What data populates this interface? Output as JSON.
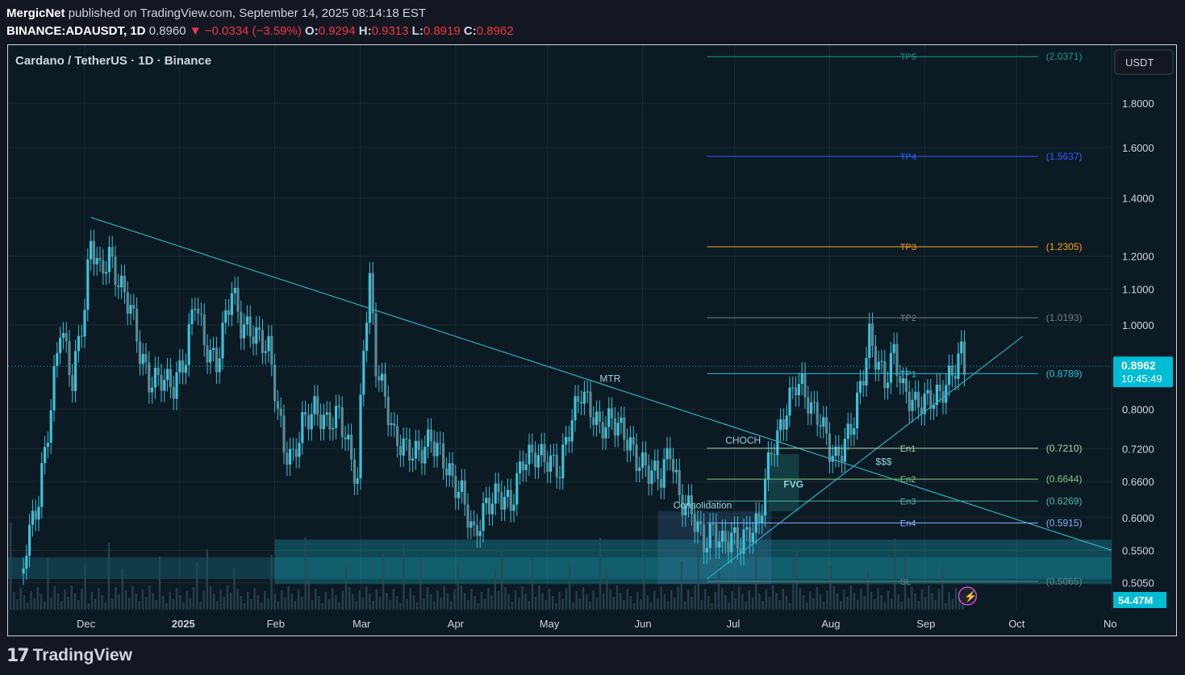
{
  "header": {
    "author": "MergicNet",
    "published_text": "published on TradingView.com, September 14, 2025 08:14:18 EST",
    "symbol": "BINANCE:ADAUSDT, 1D",
    "last": "0.8960",
    "change": "▼ −0.0334 (−3.59%)",
    "open_label": "O:",
    "open": "0.9294",
    "high_label": "H:",
    "high": "0.9313",
    "low_label": "L:",
    "low": "0.8919",
    "close_label": "C:",
    "close": "0.8962"
  },
  "legend": {
    "title": "Cardano / TetherUS · 1D · Binance"
  },
  "footer": {
    "brand": "TradingView"
  },
  "colors": {
    "bg": "#0c1a24",
    "candle": "#3dc1d9",
    "grid": "#1c2b35",
    "trend": "#2ab0c5",
    "tp3": "#f7a21b",
    "tp4": "#2962ff",
    "tp5": "#1b9a88",
    "tp2": "#787b86",
    "tp1": "#26c6da",
    "en1": "#a5d6a7",
    "en2": "#81c784",
    "en3": "#4db6ac",
    "en4": "#82b1ff",
    "sl": "#5d8a8a",
    "zone": "#17a3b3",
    "price": "#00bcd4"
  },
  "chart_data": {
    "type": "candlestick",
    "symbol": "Cardano / TetherUS",
    "timeframe": "1D",
    "exchange": "Binance",
    "currency_label": "USDT",
    "y_scale": "log",
    "ylim": [
      0.47,
      2.1
    ],
    "x_start": "2024-11-06",
    "x_end": "2025-11-01",
    "x_ticks": [
      {
        "date": "2024-12-01",
        "label": "Dec",
        "bold": false
      },
      {
        "date": "2025-01-01",
        "label": "2025",
        "bold": true
      },
      {
        "date": "2025-02-01",
        "label": "Feb",
        "bold": false
      },
      {
        "date": "2025-03-01",
        "label": "Mar",
        "bold": false
      },
      {
        "date": "2025-04-01",
        "label": "Apr",
        "bold": false
      },
      {
        "date": "2025-05-01",
        "label": "May",
        "bold": false
      },
      {
        "date": "2025-06-01",
        "label": "Jun",
        "bold": false
      },
      {
        "date": "2025-07-01",
        "label": "Jul",
        "bold": false
      },
      {
        "date": "2025-08-01",
        "label": "Aug",
        "bold": false
      },
      {
        "date": "2025-09-01",
        "label": "Sep",
        "bold": false
      },
      {
        "date": "2025-10-01",
        "label": "Oct",
        "bold": false
      },
      {
        "date": "2025-11-01",
        "label": "No",
        "bold": false
      }
    ],
    "y_ticks": [
      {
        "value": 1.8,
        "label": "1.8000"
      },
      {
        "value": 1.6,
        "label": "1.6000"
      },
      {
        "value": 1.4,
        "label": "1.4000"
      },
      {
        "value": 1.2,
        "label": "1.2000"
      },
      {
        "value": 1.1,
        "label": "1.1000"
      },
      {
        "value": 1.0,
        "label": "1.0000"
      },
      {
        "value": 0.8,
        "label": "0.8000"
      },
      {
        "value": 0.72,
        "label": "0.7200"
      },
      {
        "value": 0.66,
        "label": "0.6600"
      },
      {
        "value": 0.6,
        "label": "0.6000"
      },
      {
        "value": 0.55,
        "label": "0.5500"
      },
      {
        "value": 0.505,
        "label": "0.5050"
      }
    ],
    "close_path": [
      [
        "2024-11-06",
        0.38
      ],
      [
        "2024-11-12",
        0.56
      ],
      [
        "2024-11-16",
        0.63
      ],
      [
        "2024-11-20",
        0.8
      ],
      [
        "2024-11-23",
        1.0
      ],
      [
        "2024-11-27",
        0.86
      ],
      [
        "2024-12-01",
        1.05
      ],
      [
        "2024-12-03",
        1.25
      ],
      [
        "2024-12-06",
        1.15
      ],
      [
        "2024-12-09",
        1.2
      ],
      [
        "2024-12-12",
        1.12
      ],
      [
        "2024-12-16",
        1.05
      ],
      [
        "2024-12-19",
        0.93
      ],
      [
        "2024-12-22",
        0.86
      ],
      [
        "2024-12-26",
        0.87
      ],
      [
        "2024-12-30",
        0.85
      ],
      [
        "2025-01-03",
        0.92
      ],
      [
        "2025-01-06",
        1.08
      ],
      [
        "2025-01-09",
        0.95
      ],
      [
        "2025-01-13",
        0.9
      ],
      [
        "2025-01-18",
        1.1
      ],
      [
        "2025-01-21",
        1.0
      ],
      [
        "2025-01-25",
        0.98
      ],
      [
        "2025-01-30",
        0.94
      ],
      [
        "2025-02-02",
        0.8
      ],
      [
        "2025-02-04",
        0.72
      ],
      [
        "2025-02-07",
        0.7
      ],
      [
        "2025-02-10",
        0.77
      ],
      [
        "2025-02-14",
        0.8
      ],
      [
        "2025-02-18",
        0.77
      ],
      [
        "2025-02-22",
        0.79
      ],
      [
        "2025-02-26",
        0.7
      ],
      [
        "2025-02-28",
        0.66
      ],
      [
        "2025-03-02",
        0.95
      ],
      [
        "2025-03-04",
        1.12
      ],
      [
        "2025-03-06",
        0.9
      ],
      [
        "2025-03-08",
        0.85
      ],
      [
        "2025-03-12",
        0.74
      ],
      [
        "2025-03-16",
        0.72
      ],
      [
        "2025-03-20",
        0.71
      ],
      [
        "2025-03-24",
        0.74
      ],
      [
        "2025-03-28",
        0.7
      ],
      [
        "2025-03-31",
        0.66
      ],
      [
        "2025-04-03",
        0.64
      ],
      [
        "2025-04-07",
        0.57
      ],
      [
        "2025-04-11",
        0.62
      ],
      [
        "2025-04-15",
        0.64
      ],
      [
        "2025-04-19",
        0.62
      ],
      [
        "2025-04-23",
        0.7
      ],
      [
        "2025-04-27",
        0.71
      ],
      [
        "2025-05-01",
        0.7
      ],
      [
        "2025-05-05",
        0.68
      ],
      [
        "2025-05-08",
        0.76
      ],
      [
        "2025-05-12",
        0.84
      ],
      [
        "2025-05-15",
        0.8
      ],
      [
        "2025-05-18",
        0.76
      ],
      [
        "2025-05-22",
        0.78
      ],
      [
        "2025-05-26",
        0.75
      ],
      [
        "2025-05-30",
        0.7
      ],
      [
        "2025-06-03",
        0.68
      ],
      [
        "2025-06-07",
        0.67
      ],
      [
        "2025-06-10",
        0.72
      ],
      [
        "2025-06-13",
        0.63
      ],
      [
        "2025-06-17",
        0.61
      ],
      [
        "2025-06-21",
        0.56
      ],
      [
        "2025-06-24",
        0.58
      ],
      [
        "2025-06-27",
        0.56
      ],
      [
        "2025-06-30",
        0.57
      ],
      [
        "2025-07-03",
        0.56
      ],
      [
        "2025-07-06",
        0.58
      ],
      [
        "2025-07-09",
        0.59
      ],
      [
        "2025-07-11",
        0.66
      ],
      [
        "2025-07-13",
        0.72
      ],
      [
        "2025-07-15",
        0.74
      ],
      [
        "2025-07-18",
        0.8
      ],
      [
        "2025-07-21",
        0.86
      ],
      [
        "2025-07-23",
        0.85
      ],
      [
        "2025-07-26",
        0.8
      ],
      [
        "2025-07-29",
        0.78
      ],
      [
        "2025-08-01",
        0.72
      ],
      [
        "2025-08-03",
        0.7
      ],
      [
        "2025-08-06",
        0.73
      ],
      [
        "2025-08-09",
        0.78
      ],
      [
        "2025-08-12",
        0.88
      ],
      [
        "2025-08-14",
        0.97
      ],
      [
        "2025-08-16",
        0.92
      ],
      [
        "2025-08-19",
        0.86
      ],
      [
        "2025-08-22",
        0.93
      ],
      [
        "2025-08-25",
        0.84
      ],
      [
        "2025-08-29",
        0.81
      ],
      [
        "2025-09-02",
        0.82
      ],
      [
        "2025-09-06",
        0.83
      ],
      [
        "2025-09-10",
        0.88
      ],
      [
        "2025-09-13",
        0.93
      ],
      [
        "2025-09-14",
        0.8962
      ]
    ],
    "levels": [
      {
        "name": "TP5",
        "value": 2.0371,
        "label": "(2.0371)",
        "color": "#1b9a88"
      },
      {
        "name": "TP4",
        "value": 1.5637,
        "label": "(1.5637)",
        "color": "#2962ff"
      },
      {
        "name": "TP3",
        "value": 1.2305,
        "label": "(1.2305)",
        "color": "#f7a21b"
      },
      {
        "name": "TP2",
        "value": 1.0193,
        "label": "(1.0193)",
        "color": "#787b86"
      },
      {
        "name": "TP1",
        "value": 0.8789,
        "label": "(0.8789)",
        "color": "#26c6da"
      },
      {
        "name": "En1",
        "value": 0.721,
        "label": "(0.7210)",
        "color": "#a5d6a7"
      },
      {
        "name": "En2",
        "value": 0.6644,
        "label": "(0.6644)",
        "color": "#81c784"
      },
      {
        "name": "En3",
        "value": 0.6269,
        "label": "(0.6269)",
        "color": "#4db6ac"
      },
      {
        "name": "En4",
        "value": 0.5915,
        "label": "(0.5915)",
        "color": "#82b1ff"
      },
      {
        "name": "SL",
        "value": 0.5065,
        "label": "(0.5065)",
        "color": "#5d8a8a"
      }
    ],
    "annotations": [
      {
        "text": "MTR",
        "date": "2025-05-18",
        "value": 0.86
      },
      {
        "text": "CHOCH",
        "date": "2025-06-28",
        "value": 0.73
      },
      {
        "text": "FVG",
        "date": "2025-07-17",
        "value": 0.65
      },
      {
        "text": "Consolidation",
        "date": "2025-06-11",
        "value": 0.615
      },
      {
        "text": "$$$",
        "date": "2025-08-16",
        "value": 0.69
      }
    ],
    "current_price": {
      "value": 0.8962,
      "label": "0.8962",
      "countdown": "10:45:49"
    },
    "volume_label": "54.47M",
    "grid": true
  }
}
